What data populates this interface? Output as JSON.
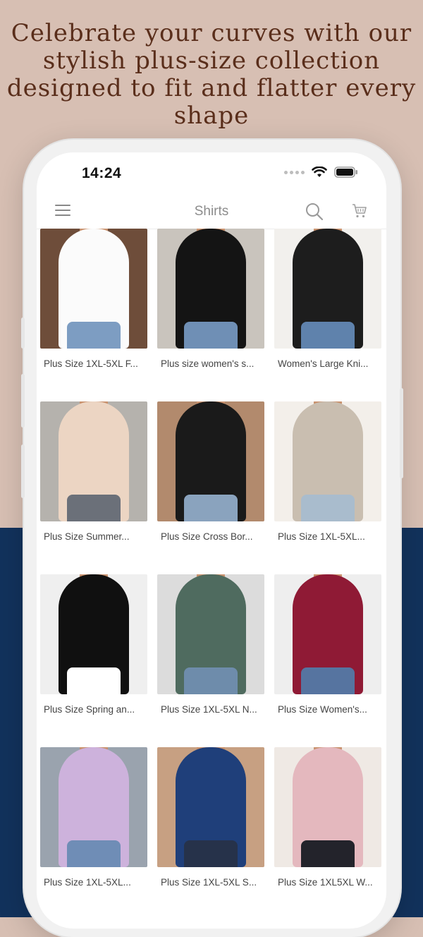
{
  "headline": "Celebrate your curves with our stylish plus-size collection designed to fit and flatter every shape",
  "status_bar": {
    "time": "14:24"
  },
  "nav": {
    "title": "Shirts"
  },
  "colors": {
    "top_background": "#d7bfb3",
    "bottom_background": "#12325c",
    "headline_text": "#5a2e1b"
  },
  "products": [
    {
      "title": "Plus Size 1XL-5XL F...",
      "top": "#fbfbfb",
      "bg": "#6e4d3a",
      "legs": "#7d9dc2"
    },
    {
      "title": "Plus size women's s...",
      "top": "#141414",
      "bg": "#c9c4bd",
      "legs": "#6f8fb5"
    },
    {
      "title": "Women's Large Kni...",
      "top": "#1d1d1d",
      "bg": "#f2f0ed",
      "legs": "#5f82ac"
    },
    {
      "title": "Plus Size Summer...",
      "top": "#ecd5c3",
      "bg": "#b5b2ad",
      "legs": "#6b7079"
    },
    {
      "title": "Plus Size Cross Bor...",
      "top": "#1a1a1a",
      "bg": "#b28a6d",
      "legs": "#8aa3be"
    },
    {
      "title": "Plus Size 1XL-5XL...",
      "top": "#c9beb0",
      "bg": "#f3efea",
      "legs": "#a9bccd"
    },
    {
      "title": "Plus Size Spring an...",
      "top": "#101010",
      "bg": "#efefef",
      "legs": "#ffffff"
    },
    {
      "title": "Plus Size 1XL-5XL N...",
      "top": "#4f6b5f",
      "bg": "#dcdcdc",
      "legs": "#6e8cab"
    },
    {
      "title": "Plus Size Women's...",
      "top": "#8f1a35",
      "bg": "#eeeeee",
      "legs": "#5674a0"
    },
    {
      "title": "Plus Size 1XL-5XL...",
      "top": "#cdb2dc",
      "bg": "#9aa3ae",
      "legs": "#6f8db6"
    },
    {
      "title": "Plus Size 1XL-5XL S...",
      "top": "#1f3f7a",
      "bg": "#c7a082",
      "legs": "#26324a"
    },
    {
      "title": "Plus Size 1XL5XL W...",
      "top": "#e4b8be",
      "bg": "#efe9e4",
      "legs": "#23232b"
    }
  ]
}
